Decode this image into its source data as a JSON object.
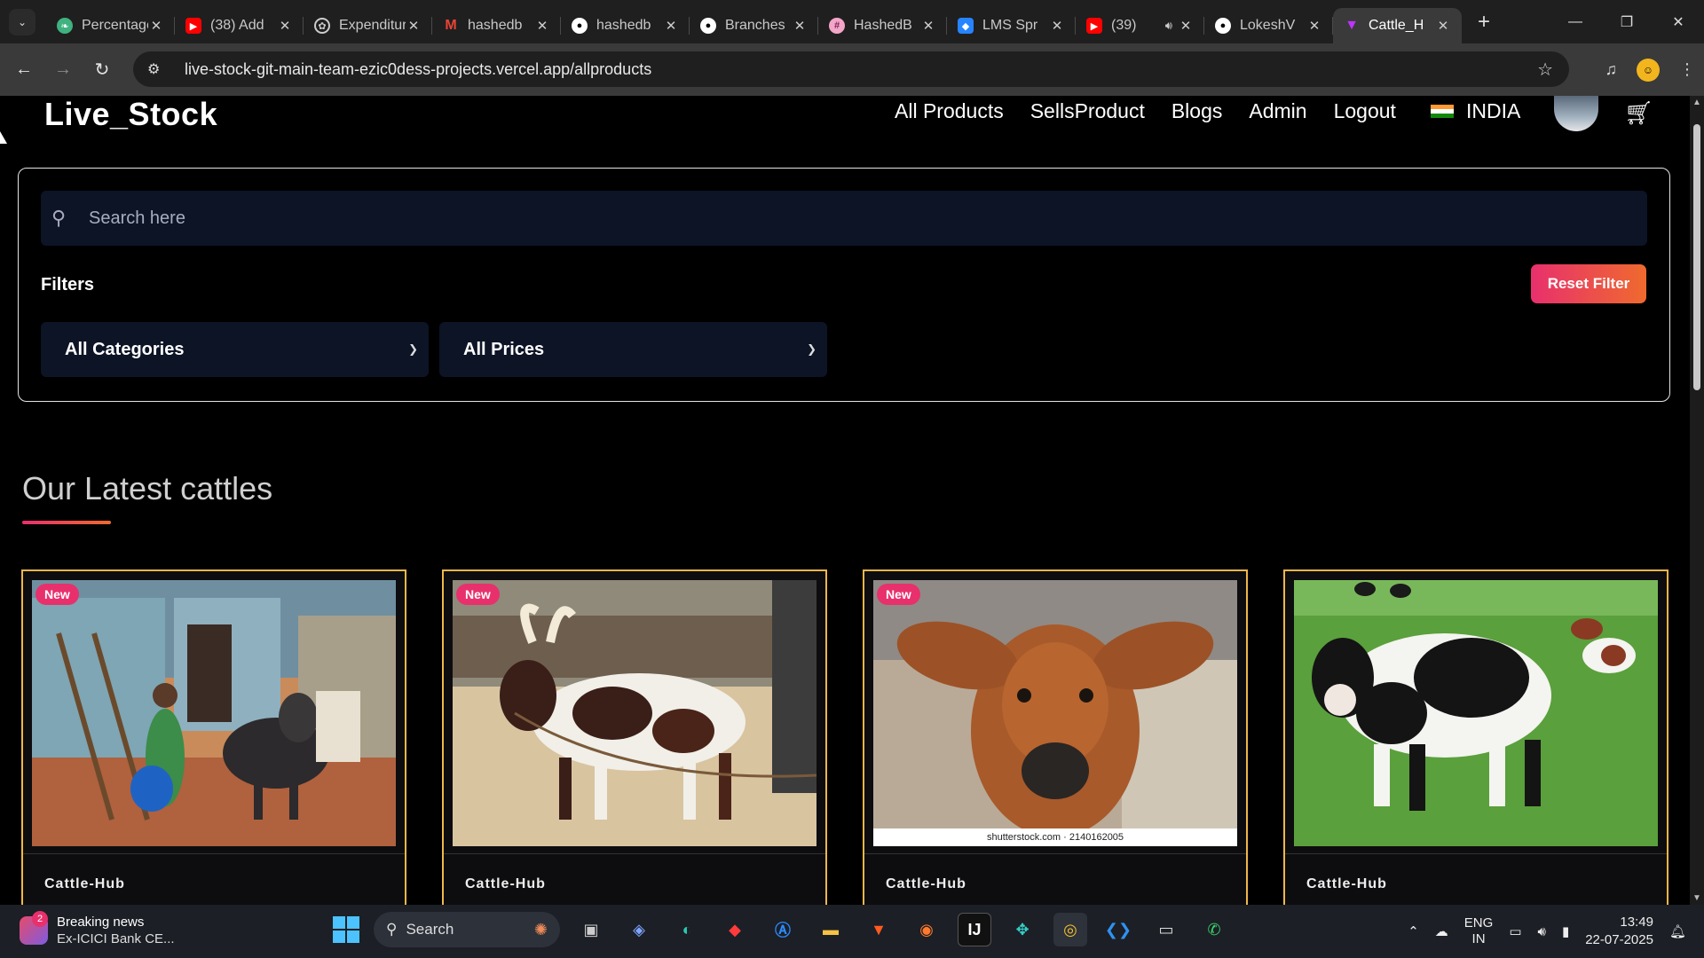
{
  "browser": {
    "tabs": [
      {
        "title": "Percentage",
        "icon": "leaf-icon",
        "color": "#3fb27f"
      },
      {
        "title": "(38) Add",
        "icon": "youtube-icon",
        "color": "#ff0000"
      },
      {
        "title": "Expenditure",
        "icon": "openai-icon",
        "color": "#cccccc"
      },
      {
        "title": "hashedb",
        "icon": "gmail-icon",
        "color": "#ea4335"
      },
      {
        "title": "hashedb",
        "icon": "github-icon",
        "color": "#ffffff"
      },
      {
        "title": "Branches",
        "icon": "github-icon",
        "color": "#ffffff"
      },
      {
        "title": "HashedB",
        "icon": "hashedbit-icon",
        "color": "#f4a6c8"
      },
      {
        "title": "LMS Spr",
        "icon": "jira-icon",
        "color": "#2684ff"
      },
      {
        "title": "(39)",
        "icon": "youtube-icon",
        "color": "#ff0000"
      },
      {
        "title": "LokeshV",
        "icon": "github-icon",
        "color": "#ffffff"
      },
      {
        "title": "Cattle_H",
        "icon": "vite-icon",
        "color": "#bd34fe"
      }
    ],
    "url": "live-stock-git-main-team-ezic0dess-projects.vercel.app/allproducts"
  },
  "site": {
    "logo": "Live_Stock",
    "nav": [
      "All Products",
      "SellsProduct",
      "Blogs",
      "Admin",
      "Logout"
    ],
    "country": "INDIA",
    "search_placeholder": "Search here",
    "filters_label": "Filters",
    "reset_label": "Reset Filter",
    "category_select": "All Categories",
    "price_select": "All Prices",
    "section_title": "Our Latest cattles",
    "cards": [
      {
        "badge": "New",
        "brand": "Cattle-Hub"
      },
      {
        "badge": "New",
        "brand": "Cattle-Hub"
      },
      {
        "badge": "New",
        "brand": "Cattle-Hub",
        "watermark": "shutterstock.com · 2140162005"
      },
      {
        "badge": "",
        "brand": "Cattle-Hub"
      }
    ]
  },
  "taskbar": {
    "news_title": "Breaking news",
    "news_sub": "Ex-ICICI Bank CE...",
    "news_count": "2",
    "search_label": "Search",
    "lang1": "ENG",
    "lang2": "IN",
    "time": "13:49",
    "date": "22-07-2025"
  },
  "colors": {
    "accent_gradient_start": "#e8306d",
    "accent_gradient_end": "#ef6a2e",
    "card_border": "#f0b74a",
    "input_bg": "#0c1426"
  }
}
